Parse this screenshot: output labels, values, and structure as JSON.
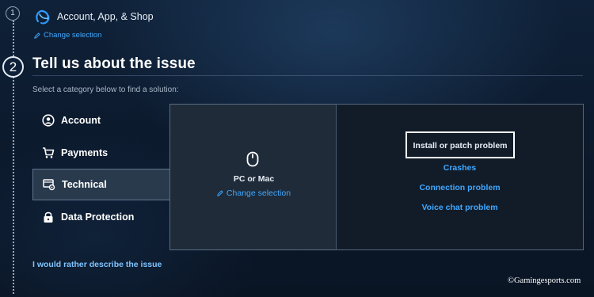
{
  "steps": {
    "step1_number": "1",
    "step2_number": "2"
  },
  "step1": {
    "title": "Account, App, & Shop",
    "change_label": "Change selection"
  },
  "step2": {
    "title": "Tell us about the issue",
    "instructions": "Select a category below to find a solution:"
  },
  "categories": [
    {
      "label": "Account",
      "icon": "user-circle-icon",
      "selected": false
    },
    {
      "label": "Payments",
      "icon": "shopping-cart-icon",
      "selected": false
    },
    {
      "label": "Technical",
      "icon": "monitor-gear-icon",
      "selected": true
    },
    {
      "label": "Data Protection",
      "icon": "padlock-icon",
      "selected": false
    }
  ],
  "device": {
    "icon": "mouse-icon",
    "label": "PC or Mac",
    "change_label": "Change selection"
  },
  "problems": [
    {
      "label": "Install or patch problem",
      "highlighted": true
    },
    {
      "label": "Crashes",
      "highlighted": false
    },
    {
      "label": "Connection problem",
      "highlighted": false
    },
    {
      "label": "Voice chat problem",
      "highlighted": false
    }
  ],
  "describe_link": "I would rather describe the issue",
  "watermark": "©Gamingesports.com",
  "colors": {
    "background": "#0c1a2d",
    "link": "#3fa8ff",
    "selected_category": "#2a3a4d",
    "device_panel": "#1f2b39",
    "problem_panel": "#121c29"
  }
}
